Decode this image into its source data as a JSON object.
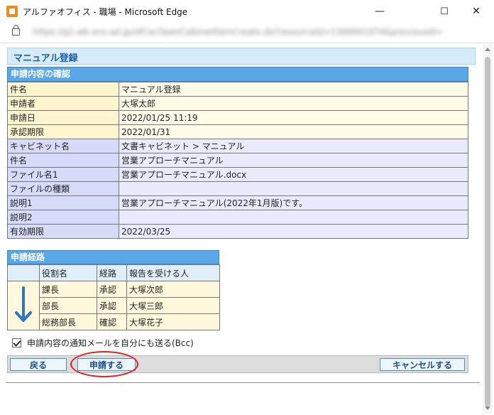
{
  "window": {
    "title": "アルファオフィス - 職場 - Microsoft Edge",
    "minimize": "—",
    "maximize": "☐",
    "close": "✕"
  },
  "address": {
    "url": "https://g2.wb.ens.ad.jp/ofCacOpenCabinetItemCreate.do?resourceId=1300001974&previousId="
  },
  "page": {
    "title": "マニュアル登録"
  },
  "confirmation": {
    "header": "申請内容の確認",
    "rows": [
      {
        "label": "件名",
        "value": "マニュアル登録"
      },
      {
        "label": "申請者",
        "value": "大塚太郎"
      },
      {
        "label": "申請日",
        "value": "2022/01/25 11:19"
      },
      {
        "label": "承認期限",
        "value": "2022/01/31"
      },
      {
        "label": "キャビネット名",
        "value": "文書キャビネット > マニュアル"
      },
      {
        "label": "件名",
        "value": "営業アプローチマニュアル"
      },
      {
        "label": "ファイル名1",
        "value": "営業アプローチマニュアル.docx"
      },
      {
        "label": "ファイルの種類",
        "value": ""
      },
      {
        "label": "説明1",
        "value": "営業アプローチマニュアル(2022年1月版)です。"
      },
      {
        "label": "説明2",
        "value": ""
      },
      {
        "label": "有効期限",
        "value": "2022/03/25"
      }
    ]
  },
  "route": {
    "header": "申請経路",
    "columns": [
      "役割名",
      "経路",
      "報告を受ける人"
    ],
    "rows": [
      {
        "role": "課長",
        "type": "承認",
        "person": "大塚次郎"
      },
      {
        "role": "部長",
        "type": "承認",
        "person": "大塚三郎"
      },
      {
        "role": "総務部長",
        "type": "確認",
        "person": "大塚花子"
      }
    ]
  },
  "notify": {
    "label": "申請内容の通知メールを自分にも送る(Bcc)",
    "checked": true
  },
  "buttons": {
    "back": "戻る",
    "submit": "申請する",
    "cancel": "キャンセルする"
  },
  "colors": {
    "accent": "#5aa7e8",
    "highlight_ring": "#e02020",
    "title_text": "#1a5fa8"
  }
}
